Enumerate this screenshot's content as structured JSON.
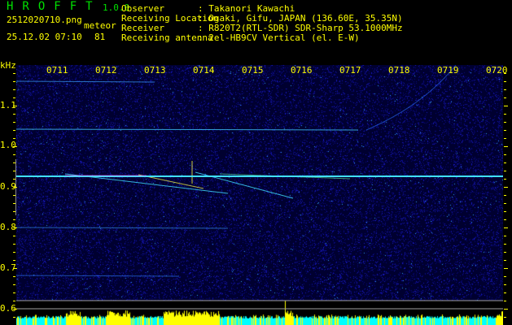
{
  "app": {
    "title": "HROFFT",
    "version": "1.0.0"
  },
  "file": {
    "name": "2512020710.png",
    "datetime": "25.12.02 07:10"
  },
  "meteor": {
    "label": "meteor",
    "count": "81"
  },
  "info": [
    {
      "key": "Observer",
      "value": ": Takanori Kawachi"
    },
    {
      "key": "Receiving Location",
      "value": ": Ogaki, Gifu, JAPAN (136.60E, 35.35N)"
    },
    {
      "key": "Receiver",
      "value": ": R820T2(RTL-SDR) SDR-Sharp 53.1000MHz"
    },
    {
      "key": "Receiving antenna",
      "value": ": 2el-HB9CV Vertical (el. E-W)"
    }
  ],
  "axis": {
    "unit": "kHz",
    "y_ticks": [
      "1.1",
      "1.0",
      "0.9",
      "0.8",
      "0.7",
      "0.6"
    ],
    "x_ticks": [
      "0711",
      "0712",
      "0713",
      "0714",
      "0715",
      "0716",
      "0717",
      "0718",
      "0719",
      "0720"
    ]
  },
  "colors": {
    "text": "#ffff00",
    "title": "#00e000",
    "noise": "#0a0a8c",
    "carrier": "#40e0ff",
    "hist_yellow": "#ffff00",
    "hist_cyan": "#00ffff"
  }
}
